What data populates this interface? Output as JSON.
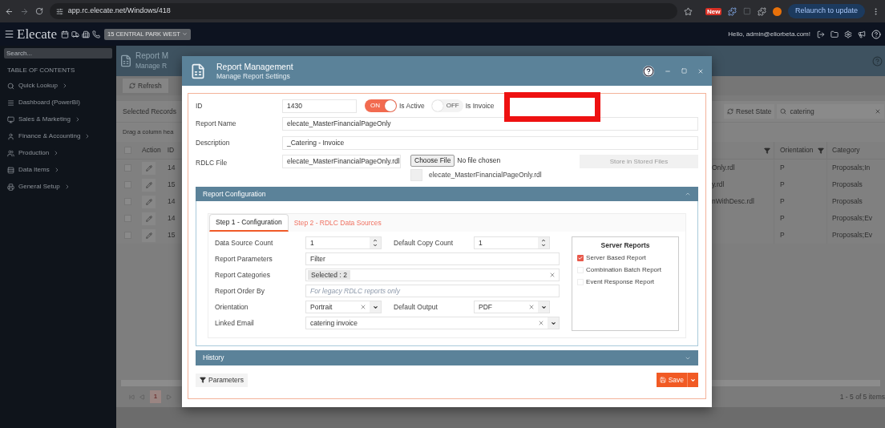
{
  "browser": {
    "url": "app.rc.elecate.net/Windows/418",
    "extension_badge": "New",
    "relaunch_button": "Relaunch to update"
  },
  "app_header": {
    "logo": "Elecate",
    "property_button": "15 CENTRAL PARK WEST",
    "greeting": "Hello, admin@eliorbeta.com!"
  },
  "sidebar": {
    "search_placeholder": "Search...",
    "toc_title": "TABLE OF CONTENTS",
    "items": [
      {
        "label": "Quick Lookup",
        "has_children": true
      },
      {
        "label": "Dashboard (PowerBI)",
        "has_children": false
      },
      {
        "label": "Sales & Marketing",
        "has_children": true
      },
      {
        "label": "Finance & Accounting",
        "has_children": true
      },
      {
        "label": "Production",
        "has_children": true
      },
      {
        "label": "Data Items",
        "has_children": true
      },
      {
        "label": "General Setup",
        "has_children": true
      }
    ]
  },
  "page": {
    "title": "Report M",
    "subtitle": "Manage R",
    "refresh_button": "Refresh",
    "selected_label": "Selected Records",
    "group_hint": "Drag a column hea",
    "reset_button": "Reset State",
    "search_value": "catering",
    "select_all_checked": false,
    "columns": {
      "action": "Action",
      "id": "ID",
      "orientation": "Orientation",
      "category": "Category"
    },
    "rows": [
      {
        "checked": false,
        "id": "14",
        "file": "Only.rdl",
        "orientation": "P",
        "category": "Proposals;In"
      },
      {
        "checked": false,
        "id": "15",
        "file": "y.rdl",
        "orientation": "P",
        "category": "Proposals"
      },
      {
        "checked": false,
        "id": "14",
        "file": "nWithDesc.rdl",
        "orientation": "P",
        "category": "Proposals"
      },
      {
        "checked": false,
        "id": "14",
        "orientation": "P",
        "category": "Proposals;Ev"
      },
      {
        "checked": false,
        "id": "15",
        "orientation": "P",
        "category": "Proposals;Ev"
      }
    ],
    "pager_page": "1",
    "pager_summary": "1 - 5 of 5 items"
  },
  "modal": {
    "title": "Report Management",
    "subtitle": "Manage Report Settings",
    "id_label": "ID",
    "id_value": "1430",
    "toggles": [
      {
        "label": "Is Active",
        "on": true,
        "caption": "ON"
      },
      {
        "label": "Is Invoice",
        "on": false,
        "caption": "OFF"
      }
    ],
    "report_name": {
      "label": "Report Name",
      "value": "elecate_MasterFinancialPageOnly"
    },
    "description": {
      "label": "Description",
      "value": "_Catering - Invoice"
    },
    "rdlc": {
      "label": "RDLC File",
      "value": "elecate_MasterFinancialPageOnly.rdl",
      "choose_button": "Choose File",
      "file_status": "No file chosen",
      "stored_file": "elecate_MasterFinancialPageOnly.rdl",
      "store_button": "Store in Stored Files",
      "store_disabled": true
    },
    "config": {
      "title": "Report Configuration",
      "expanded": true,
      "tabs": [
        {
          "label": "Step 1 - Configuration",
          "selected": true
        },
        {
          "label": "Step 2 - RDLC Data Sources",
          "selected": false
        }
      ],
      "rows": [
        {
          "fields": [
            {
              "kind": "spinner",
              "label": "Data Source Count",
              "value": "1"
            },
            {
              "kind": "spinner",
              "label": "Default Copy Count",
              "value": "1"
            }
          ]
        },
        {
          "fields": [
            {
              "kind": "text",
              "label": "Report Parameters",
              "value": "Filter"
            }
          ]
        },
        {
          "fields": [
            {
              "kind": "multiselect",
              "label": "Report Categories",
              "value": "Selected : 2"
            }
          ]
        },
        {
          "fields": [
            {
              "kind": "text",
              "label": "Report Order By",
              "placeholder": "For legacy RDLC reports only"
            }
          ]
        },
        {
          "fields": [
            {
              "kind": "dropdown",
              "label": "Orientation",
              "value": "Portrait"
            },
            {
              "kind": "dropdown",
              "label": "Default Output",
              "value": "PDF"
            }
          ]
        },
        {
          "fields": [
            {
              "kind": "dropdown",
              "label": "Linked Email",
              "value": "catering invoice"
            }
          ]
        }
      ],
      "server_reports": {
        "title": "Server Reports",
        "options": [
          {
            "label": "Server Based Report",
            "checked": true
          },
          {
            "label": "Combination Batch Report",
            "checked": false
          },
          {
            "label": "Event Response Report",
            "checked": false
          }
        ]
      }
    },
    "history": {
      "title": "History",
      "expanded": false
    },
    "parameters_button": "Parameters",
    "save_button": "Save"
  }
}
